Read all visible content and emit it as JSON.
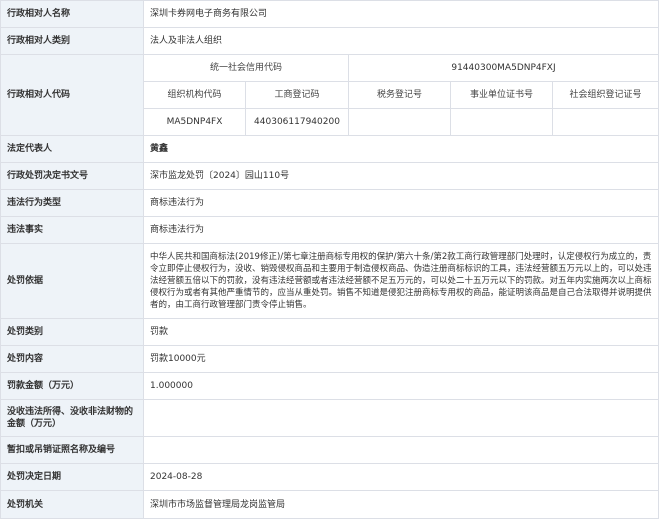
{
  "rows": {
    "name": {
      "label": "行政相对人名称",
      "value": "深圳卡券网电子商务有限公司"
    },
    "category": {
      "label": "行政相对人类别",
      "value": "法人及非法人组织"
    },
    "code": {
      "label": "行政相对人代码",
      "uscc_label": "统一社会信用代码",
      "uscc_value": "91440300MA5DNP4FXJ",
      "sub_headers": [
        "组织机构代码",
        "工商登记码",
        "税务登记号",
        "事业单位证书号",
        "社会组织登记证号"
      ],
      "sub_values": [
        "MA5DNP4FX",
        "440306117940200",
        "",
        "",
        ""
      ]
    },
    "legal_rep": {
      "label": "法定代表人",
      "value": "黄鑫"
    },
    "doc_no": {
      "label": "行政处罚决定书文号",
      "value": "深市监龙处罚〔2024〕园山110号"
    },
    "violation_type": {
      "label": "违法行为类型",
      "value": "商标违法行为"
    },
    "violation_fact": {
      "label": "违法事实",
      "value": "商标违法行为"
    },
    "basis": {
      "label": "处罚依据",
      "value": "中华人民共和国商标法(2019修正)/第七章注册商标专用权的保护/第六十条/第2款工商行政管理部门处理时，认定侵权行为成立的，责令立即停止侵权行为，没收、销毁侵权商品和主要用于制造侵权商品、伪造注册商标标识的工具，违法经营额五万元以上的，可以处违法经营额五倍以下的罚款，没有违法经营额或者违法经营额不足五万元的，可以处二十五万元以下的罚款。对五年内实施两次以上商标侵权行为或者有其他严重情节的，应当从重处罚。销售不知道是侵犯注册商标专用权的商品，能证明该商品是自己合法取得并说明提供者的，由工商行政管理部门责令停止销售。"
    },
    "penalty_type": {
      "label": "处罚类别",
      "value": "罚款"
    },
    "penalty_content": {
      "label": "处罚内容",
      "value": "罚款10000元"
    },
    "fine_amount": {
      "label": "罚款金额（万元）",
      "value": "1.000000"
    },
    "confiscation": {
      "label": "没收违法所得、没收非法财物的金额（万元）",
      "value": ""
    },
    "license": {
      "label": "暂扣或吊销证照名称及编号",
      "value": ""
    },
    "decision_date": {
      "label": "处罚决定日期",
      "value": "2024-08-28"
    },
    "authority": {
      "label": "处罚机关",
      "value": "深圳市市场监督管理局龙岗监管局"
    }
  }
}
